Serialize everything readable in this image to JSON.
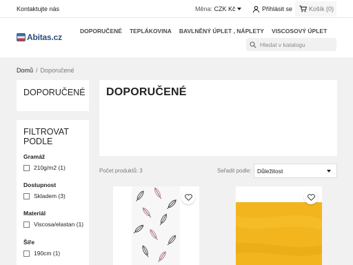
{
  "topbar": {
    "contact": "Kontaktujte nás",
    "currency_label": "Měna:",
    "currency_value": "CZK Kč",
    "login": "Přihlásit se",
    "cart": "Košík (0)"
  },
  "header": {
    "logo_text": "Abitas.cz",
    "menu": [
      "DOPORUČENÉ",
      "TEPLÁKOVINA",
      "BAVLNĚNÝ ÚPLET , NÁPLETY",
      "VISCOSOVÝ ÚPLET"
    ],
    "search_placeholder": "Hledat v katalogu"
  },
  "breadcrumb": {
    "home": "Domů",
    "separator": "/",
    "current": "Doporučené"
  },
  "sidebar": {
    "category_title": "DOPORUČENÉ",
    "filter_title": "FILTROVAT PODLE",
    "groups": [
      {
        "title": "Gramáž",
        "option": "210g/m2 (1)"
      },
      {
        "title": "Dostupnost",
        "option": "Skladem (3)"
      },
      {
        "title": "Materiál",
        "option": "Viscosa/elastan (1)"
      },
      {
        "title": "Šíře",
        "option": "190cm (1)"
      }
    ]
  },
  "main": {
    "title": "DOPORUČENÉ",
    "count": "Počet produktů: 3",
    "sort_label": "Seřadit podle:",
    "sort_value": "Důležitost"
  },
  "products": [
    {
      "image": "feather-pattern-fabric"
    },
    {
      "image": "yellow-fabric"
    }
  ],
  "colors": {
    "accent": "#24b9d7",
    "background": "#f1f1f1",
    "fabric_yellow": "#f3b51e"
  }
}
